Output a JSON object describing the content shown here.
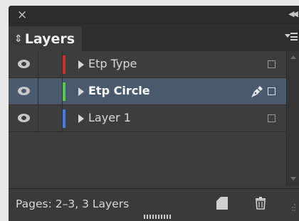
{
  "window": {
    "close_glyph": "×",
    "collapse_glyph": "◀◀"
  },
  "panel": {
    "tab_label": "Layers",
    "tab_glyph": "⇕"
  },
  "layers": [
    {
      "name": "Etp Type",
      "color": "#d62b2b",
      "visible": true,
      "selected": false
    },
    {
      "name": "Etp Circle",
      "color": "#5ec84a",
      "visible": true,
      "selected": true,
      "editing": true
    },
    {
      "name": "Layer 1",
      "color": "#4a7cd6",
      "visible": true,
      "selected": false
    }
  ],
  "footer": {
    "status": "Pages: 2–3, 3 Layers"
  },
  "icons": {
    "eye": "eye-icon",
    "pen": "pen-icon",
    "new_layer": "new-layer-icon",
    "trash": "trash-icon",
    "panel_menu": "panel-menu-icon"
  }
}
